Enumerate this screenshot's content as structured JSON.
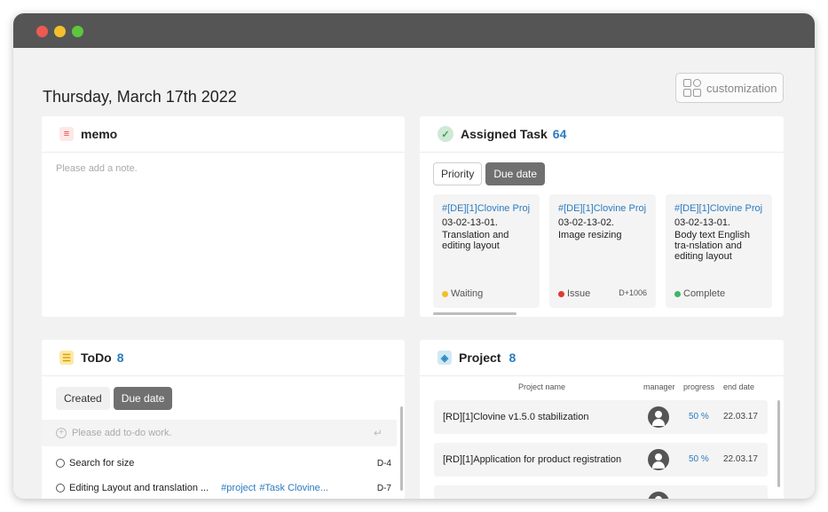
{
  "window": {
    "controls": [
      "close",
      "minimize",
      "maximize"
    ]
  },
  "header": {
    "date": "Thursday, March 17th 2022",
    "customization_label": "customization"
  },
  "memo": {
    "title": "memo",
    "placeholder": "Please add a note."
  },
  "assigned_task": {
    "title": "Assigned Task",
    "count": "64",
    "tabs": [
      {
        "label": "Priority",
        "active": false
      },
      {
        "label": "Due date",
        "active": true
      }
    ],
    "tasks": [
      {
        "link": "#[DE][1]Clovine Proj..",
        "code": "03-02-13-01.",
        "title": "Translation and editing layout",
        "status": "Waiting",
        "status_color": "#f4bf2c",
        "dday": ""
      },
      {
        "link": "#[DE][1]Clovine Proj..",
        "code": "03-02-13-02.",
        "title": "Image resizing",
        "status": "Issue",
        "status_color": "#e03a2f",
        "dday": "D+1006"
      },
      {
        "link": "#[DE][1]Clovine Proj..",
        "code": "03-02-13-01.",
        "title": "Body text English tra-nslation and editing layout",
        "status": "Complete",
        "status_color": "#3fb56a",
        "dday": ""
      }
    ]
  },
  "todo": {
    "title": "ToDo",
    "count": "8",
    "tabs": [
      {
        "label": "Created",
        "active": false
      },
      {
        "label": "Due date",
        "active": true
      }
    ],
    "add_placeholder": "Please add to-do work.",
    "items": [
      {
        "label": "Search for size",
        "tags": "",
        "tags2": "",
        "dday": "D-4"
      },
      {
        "label": "Editing Layout and translation ...",
        "tags": "#project",
        "tags2": "#Task Clovine...",
        "dday": "D-7"
      }
    ]
  },
  "project": {
    "title": "Project",
    "count": "8",
    "columns": {
      "name": "Project name",
      "manager": "manager",
      "progress": "progress",
      "end": "end date"
    },
    "rows": [
      {
        "name": "[RD][1]Clovine v1.5.0 stabilization",
        "progress": "50 %",
        "end": "22.03.17"
      },
      {
        "name": "[RD][1]Application for product registration",
        "progress": "50 %",
        "end": "22.03.17"
      },
      {
        "name": "",
        "progress": "",
        "end": ""
      }
    ]
  },
  "colors": {
    "accent": "#2c7bc0",
    "titlebar": "#555555",
    "active_tab": "#707070"
  }
}
